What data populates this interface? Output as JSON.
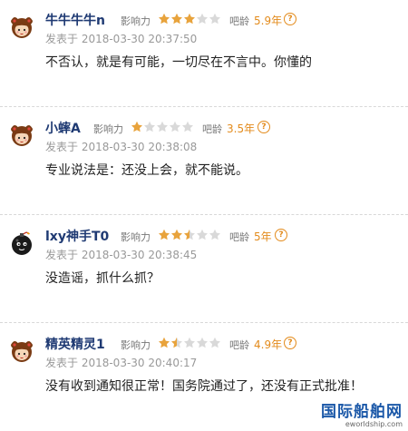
{
  "comments": [
    {
      "username": "牛牛牛牛n",
      "influence_label": "影响力",
      "rating": 3,
      "age_label": "吧龄",
      "age_value": "5.9年",
      "posted_at": "发表于 2018-03-30 20:37:50",
      "text": "不否认，就是有可能，一切尽在不言中。你懂的",
      "avatar_icon": "cartoon-girl-avatar-icon"
    },
    {
      "username": "小蟀A",
      "influence_label": "影响力",
      "rating": 1,
      "age_label": "吧龄",
      "age_value": "3.5年",
      "posted_at": "发表于 2018-03-30 20:38:08",
      "text": "专业说法是：还没上会，就不能说。",
      "avatar_icon": "cartoon-girl-avatar-icon"
    },
    {
      "username": "lxy神手T0",
      "influence_label": "影响力",
      "rating": 2.5,
      "age_label": "吧龄",
      "age_value": "5年",
      "posted_at": "发表于 2018-03-30 20:38:45",
      "text": "没造谣，抓什么抓？",
      "avatar_icon": "black-bomb-avatar-icon"
    },
    {
      "username": "精英精灵1",
      "influence_label": "影响力",
      "rating": 1.5,
      "age_label": "吧龄",
      "age_value": "4.9年",
      "posted_at": "发表于 2018-03-30 20:40:17",
      "text": "没有收到通知很正常！国务院通过了，还没有正式批准！",
      "avatar_icon": "cartoon-girl-avatar-icon"
    }
  ],
  "stars_total": 5,
  "help_icon_glyph": "?",
  "colors": {
    "username": "#1f3a73",
    "star_filled": "#e8a33c",
    "star_empty": "#d9d9d9",
    "age_value": "#e38b1c",
    "watermark": "#1b58a8"
  },
  "watermark": {
    "title": "国际船舶网",
    "url": "eworldship.com"
  }
}
